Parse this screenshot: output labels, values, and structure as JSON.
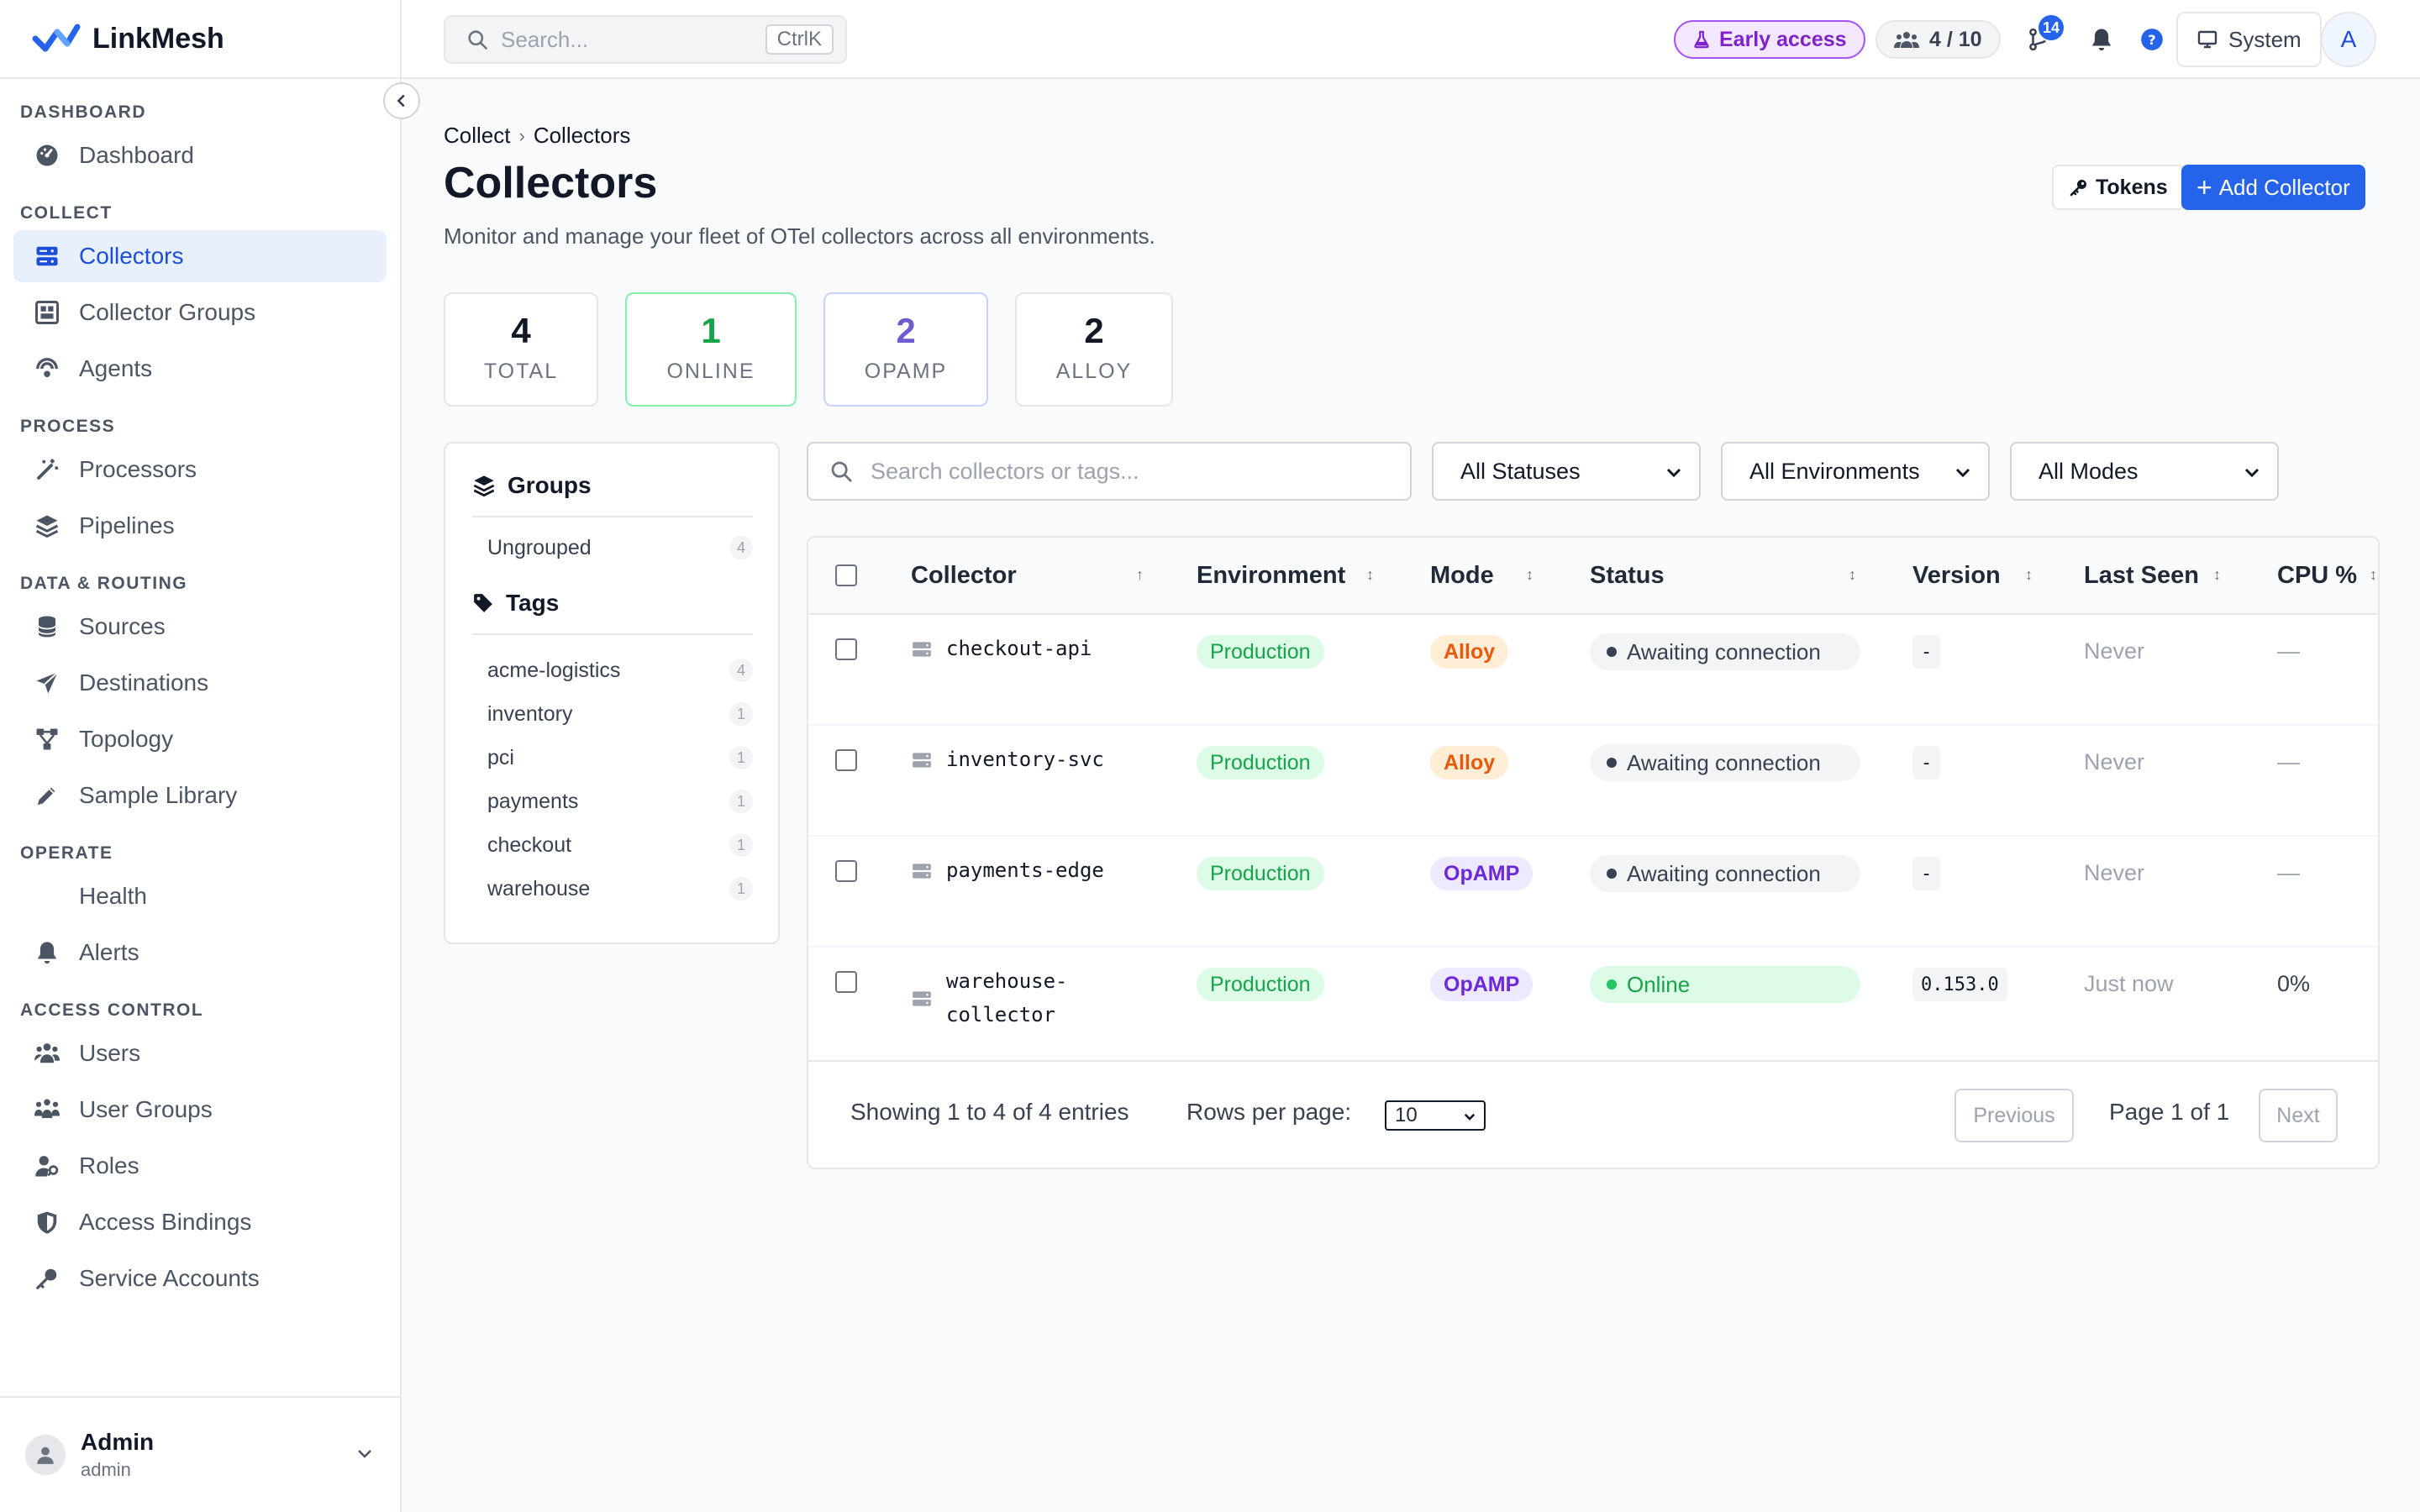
{
  "app": {
    "name": "LinkMesh"
  },
  "sidebar": {
    "sections": [
      {
        "title": "DASHBOARD",
        "items": [
          {
            "label": "Dashboard",
            "icon": "dashboard-icon"
          }
        ]
      },
      {
        "title": "COLLECT",
        "items": [
          {
            "label": "Collectors",
            "icon": "server-icon",
            "active": true
          },
          {
            "label": "Collector Groups",
            "icon": "group-icon"
          },
          {
            "label": "Agents",
            "icon": "agents-icon"
          }
        ]
      },
      {
        "title": "PROCESS",
        "items": [
          {
            "label": "Processors",
            "icon": "wand-icon"
          },
          {
            "label": "Pipelines",
            "icon": "layers-icon"
          }
        ]
      },
      {
        "title": "DATA & ROUTING",
        "items": [
          {
            "label": "Sources",
            "icon": "database-icon"
          },
          {
            "label": "Destinations",
            "icon": "send-icon"
          },
          {
            "label": "Topology",
            "icon": "topology-icon"
          },
          {
            "label": "Sample Library",
            "icon": "pen-icon"
          }
        ]
      },
      {
        "title": "OPERATE",
        "items": [
          {
            "label": "Health",
            "icon": "heart-pulse-icon"
          },
          {
            "label": "Alerts",
            "icon": "bell-icon"
          }
        ]
      },
      {
        "title": "ACCESS CONTROL",
        "items": [
          {
            "label": "Users",
            "icon": "users-icon"
          },
          {
            "label": "User Groups",
            "icon": "user-groups-icon"
          },
          {
            "label": "Roles",
            "icon": "user-key-icon"
          },
          {
            "label": "Access Bindings",
            "icon": "shield-icon"
          },
          {
            "label": "Service Accounts",
            "icon": "key-icon"
          }
        ]
      }
    ],
    "user": {
      "name": "Admin",
      "handle": "admin"
    }
  },
  "topbar": {
    "search_placeholder": "Search...",
    "search_shortcut": "CtrlK",
    "early_access": "Early access",
    "seats": "4 / 10",
    "pr_badge": "14",
    "theme": "System",
    "avatar_letter": "A"
  },
  "breadcrumb": [
    "Collect",
    "Collectors"
  ],
  "page": {
    "title": "Collectors",
    "subtitle": "Monitor and manage your fleet of OTel collectors across all environments.",
    "tokens_label": "Tokens",
    "add_label": "Add Collector"
  },
  "stats": [
    {
      "value": "4",
      "label": "TOTAL",
      "color": "#111827",
      "border": "#e5e7eb"
    },
    {
      "value": "1",
      "label": "ONLINE",
      "color": "#16a34a",
      "border": "#86efac"
    },
    {
      "value": "2",
      "label": "OPAMP",
      "color": "#6d5bd0",
      "border": "#c7d2fe"
    },
    {
      "value": "2",
      "label": "ALLOY",
      "color": "#111827",
      "border": "#e5e7eb"
    }
  ],
  "groups_panel": {
    "groups_title": "Groups",
    "groups": [
      {
        "label": "Ungrouped",
        "count": "4"
      }
    ],
    "tags_title": "Tags",
    "tags": [
      {
        "label": "acme-logistics",
        "count": "4"
      },
      {
        "label": "inventory",
        "count": "1"
      },
      {
        "label": "pci",
        "count": "1"
      },
      {
        "label": "payments",
        "count": "1"
      },
      {
        "label": "checkout",
        "count": "1"
      },
      {
        "label": "warehouse",
        "count": "1"
      }
    ]
  },
  "filters": {
    "search_placeholder": "Search collectors or tags...",
    "status": "All Statuses",
    "environment": "All Environments",
    "mode": "All Modes"
  },
  "table": {
    "columns": {
      "collector": "Collector",
      "environment": "Environment",
      "mode": "Mode",
      "status": "Status",
      "version": "Version",
      "last_seen": "Last Seen",
      "cpu": "CPU %"
    },
    "rows": [
      {
        "name": [
          "checkout-api"
        ],
        "environment": "Production",
        "mode": "Alloy",
        "status": "Awaiting connection",
        "version": "-",
        "last_seen": "Never",
        "cpu": "—"
      },
      {
        "name": [
          "inventory-svc"
        ],
        "environment": "Production",
        "mode": "Alloy",
        "status": "Awaiting connection",
        "version": "-",
        "last_seen": "Never",
        "cpu": "—"
      },
      {
        "name": [
          "payments-edge"
        ],
        "environment": "Production",
        "mode": "OpAMP",
        "status": "Awaiting connection",
        "version": "-",
        "last_seen": "Never",
        "cpu": "—"
      },
      {
        "name": [
          "warehouse-",
          "collector"
        ],
        "environment": "Production",
        "mode": "OpAMP",
        "status": "Online",
        "version": "0.153.0",
        "last_seen": "Just now",
        "cpu": "0%"
      }
    ],
    "footer": {
      "showing": "Showing 1 to 4 of 4 entries",
      "rows_per_page_label": "Rows per page:",
      "rows_per_page": "10",
      "previous": "Previous",
      "page_info": "Page 1 of 1",
      "next": "Next"
    }
  }
}
